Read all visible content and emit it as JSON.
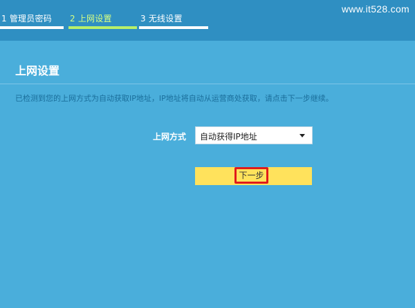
{
  "header": {
    "steps": [
      {
        "label": "1 管理员密码"
      },
      {
        "label": "2 上网设置"
      },
      {
        "label": "3 无线设置"
      }
    ],
    "watermark": "www.it528.com"
  },
  "main": {
    "title": "上网设置",
    "hint": "已检测到您的上网方式为自动获取IP地址，IP地址将自动从运营商处获取，请点击下一步继续。",
    "connection_type": {
      "label": "上网方式",
      "selected": "自动获得IP地址"
    },
    "next_button_label": "下一步"
  },
  "colors": {
    "background": "#4aaedb",
    "header_bar": "#2f8fc2",
    "active_step": "#d7ff82",
    "button": "#ffe25c",
    "highlight_box": "#e01b1b"
  }
}
